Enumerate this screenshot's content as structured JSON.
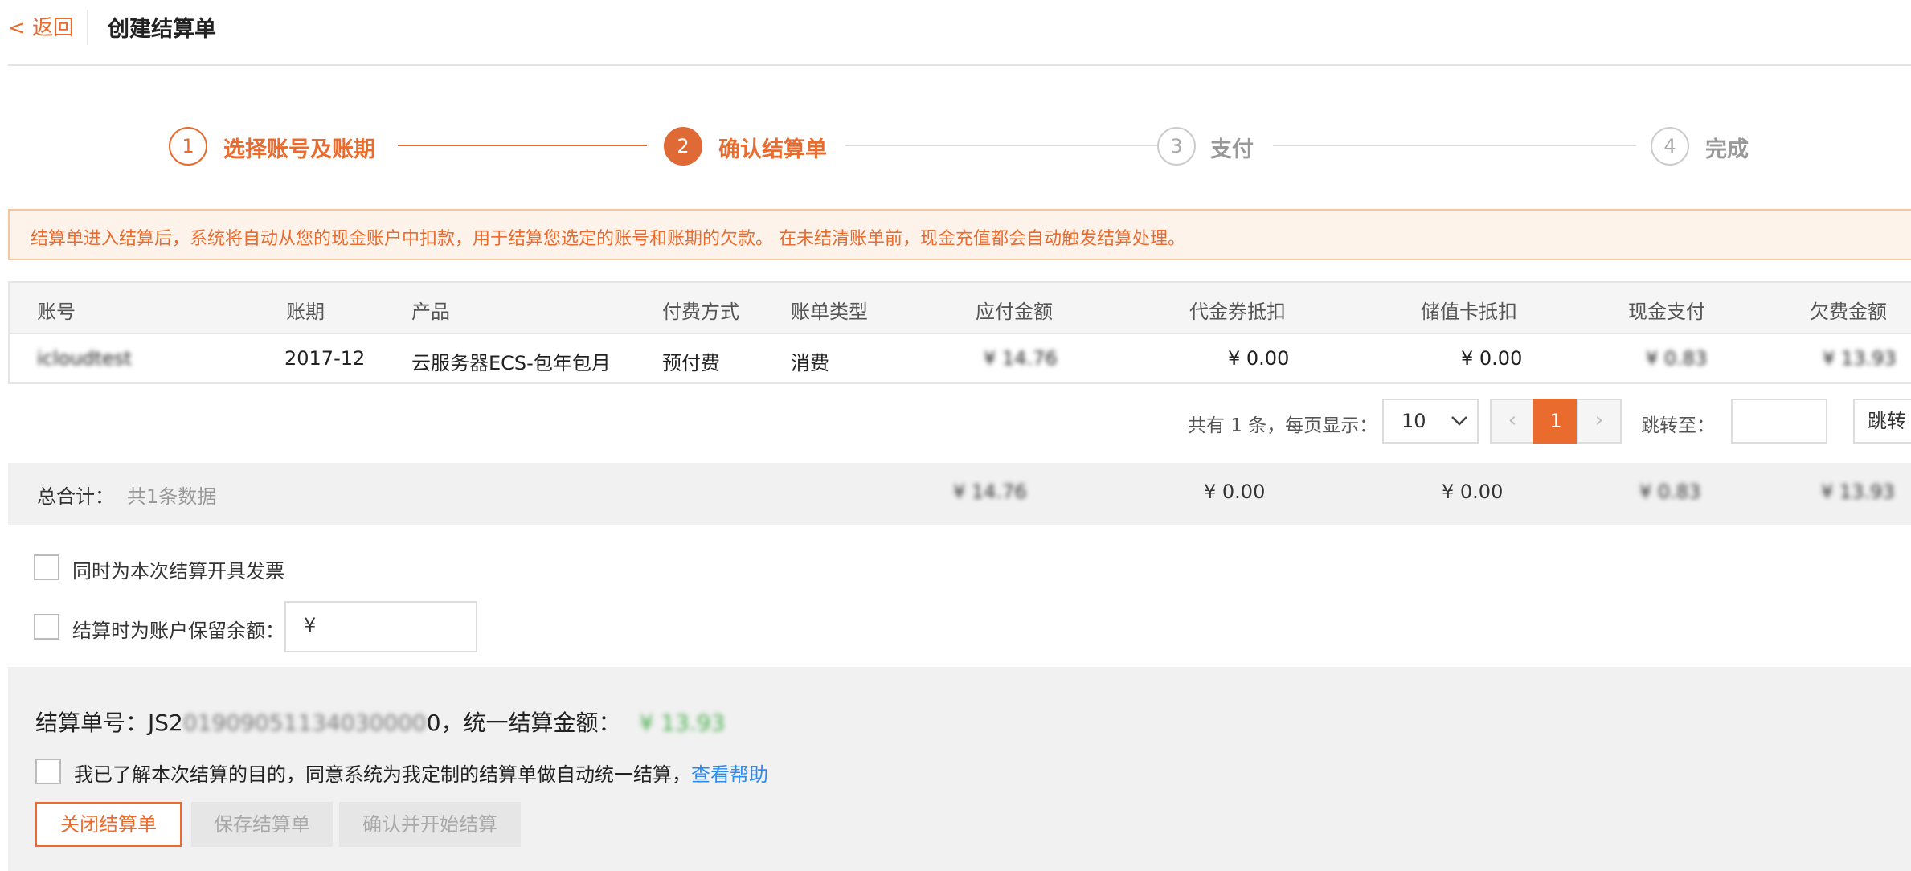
{
  "header": {
    "back_label": "< 返回",
    "title": "创建结算单"
  },
  "steps": [
    {
      "number": "1",
      "label": "选择账号及账期"
    },
    {
      "number": "2",
      "label": "确认结算单"
    },
    {
      "number": "3",
      "label": "支付"
    },
    {
      "number": "4",
      "label": "完成"
    }
  ],
  "notice": "结算单进入结算后，系统将自动从您的现金账户中扣款，用于结算您选定的账号和账期的欠款。 在未结清账单前，现金充值都会自动触发结算处理。",
  "table": {
    "columns": [
      "账号",
      "账期",
      "产品",
      "付费方式",
      "账单类型",
      "应付金额",
      "代金券抵扣",
      "储值卡抵扣",
      "现金支付",
      "欠费金额"
    ],
    "row": {
      "account": "icloudtest",
      "period": "2017-12",
      "product": "云服务器ECS-包年包月",
      "payment": "预付费",
      "bill_type": "消费",
      "payable": "¥ 14.76",
      "coupon": "¥ 0.00",
      "card": "¥ 0.00",
      "cash": "¥ 0.83",
      "owed": "¥ 13.93"
    }
  },
  "pagination": {
    "summary": "共有 1 条，每页显示：",
    "page_size": "10",
    "prev": "‹",
    "current_page": "1",
    "next": "›",
    "jump_label": "跳转至：",
    "jump_button": "跳转"
  },
  "totals": {
    "label": "总合计：",
    "count": "共1条数据",
    "payable": "¥ 14.76",
    "coupon": "¥ 0.00",
    "card": "¥ 0.00",
    "cash": "¥ 0.83",
    "owed": "¥ 13.93"
  },
  "options": {
    "invoice_label": "同时为本次结算开具发票",
    "reserve_label": "结算时为账户保留余额：",
    "currency_prefix": "¥"
  },
  "settlement": {
    "number_label": "结算单号：JS2",
    "number_hidden": "01909051134030000",
    "number_tail": "0，统一结算金额：",
    "amount": "¥ 13.93",
    "agree_text": "我已了解本次结算的目的，同意系统为我定制的结算单做自动统一结算，",
    "help_link": "查看帮助"
  },
  "buttons": {
    "close": "关闭结算单",
    "save": "保存结算单",
    "confirm": "确认并开始结算"
  },
  "colors": {
    "accent": "#e96b2e",
    "link": "#2a8bf5",
    "amount_green": "#4caf50"
  }
}
